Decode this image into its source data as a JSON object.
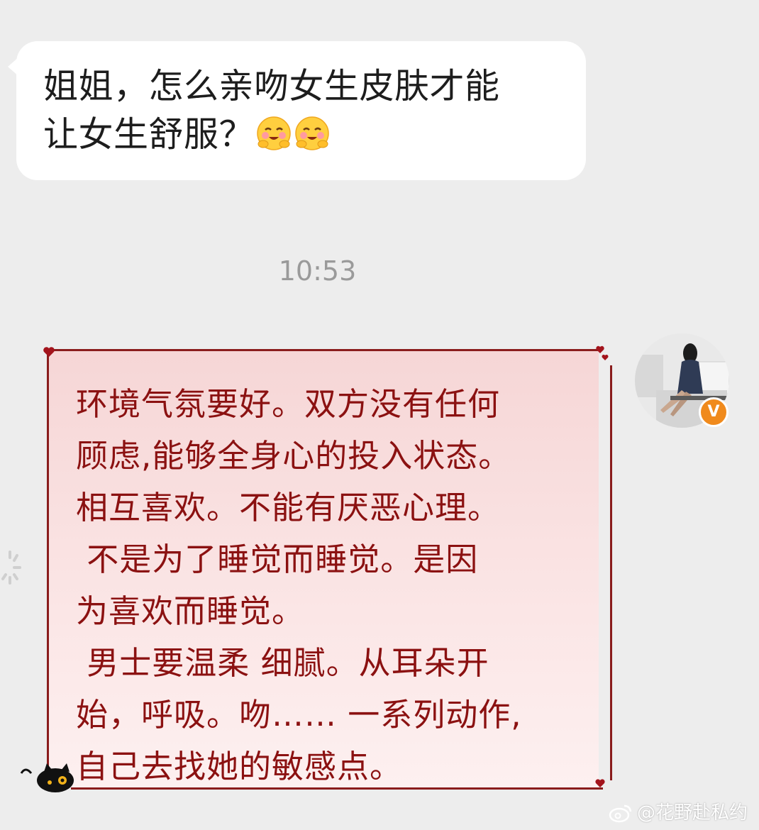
{
  "incoming": {
    "line1": "姐姐，怎么亲吻女生皮肤才能",
    "line2": "让女生舒服？",
    "emojis": [
      "blushing-smile-emoji",
      "blushing-smile-emoji"
    ]
  },
  "timestamp": "10:53",
  "outgoing": {
    "lines": [
      "环境气氛要好。双方没有任何",
      "顾虑,能够全身心的投入状态。",
      "相互喜欢。不能有厌恶心理。",
      " 不是为了睡觉而睡觉。是因",
      "为喜欢而睡觉。",
      " 男士要温柔 细腻。从耳朵开",
      "始，呼吸。吻…… 一系列动作,",
      "自己去找她的敏感点。"
    ]
  },
  "avatar": {
    "badge": "V",
    "badge_color": "#f08a1c"
  },
  "watermark": "@花野赴私约",
  "colors": {
    "background": "#ededed",
    "frame": "#8a1c1c",
    "message_text": "#8b1111",
    "card_fill": "#f6d6d6"
  }
}
